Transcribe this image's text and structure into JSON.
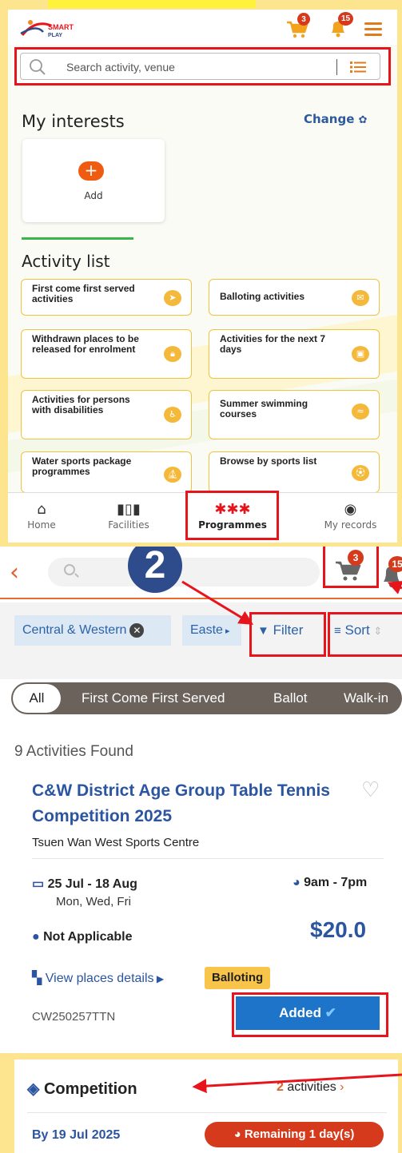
{
  "screen1": {
    "header": {
      "logo_top": "SMART",
      "logo_bottom": "PLAY",
      "cart_count": "3",
      "bell_count": "15",
      "icons": [
        "cart-icon",
        "bell-icon",
        "hamburger-menu-icon"
      ]
    },
    "search": {
      "placeholder": "Search activity, venue"
    },
    "interests": {
      "title": "My interests",
      "change_label": "Change",
      "add_label": "Add"
    },
    "activity_list": {
      "title": "Activity list",
      "items": [
        {
          "label": "First come first served activities",
          "icon": "paper-plane-icon"
        },
        {
          "label": "Balloting activities",
          "icon": "ballot-box-icon"
        },
        {
          "label": "Withdrawn places to be released for enrolment",
          "icon": "lock-icon"
        },
        {
          "label": "Activities for the next 7 days",
          "icon": "calendar-icon"
        },
        {
          "label": "Activities for persons with disabilities",
          "icon": "wheelchair-icon"
        },
        {
          "label": "Summer swimming courses",
          "icon": "swimming-icon"
        },
        {
          "label": "Water sports package programmes",
          "icon": "boat-icon"
        },
        {
          "label": "Browse by sports list",
          "icon": "ball-icon"
        }
      ]
    },
    "nav": [
      {
        "label": "Home",
        "icon": "home-icon"
      },
      {
        "label": "Facilities",
        "icon": "facilities-icon"
      },
      {
        "label": "Programmes",
        "icon": "programmes-icon"
      },
      {
        "label": "My records",
        "icon": "eye-icon"
      }
    ]
  },
  "step_number": "2",
  "screen2": {
    "cart_count": "3",
    "bell_count": "15",
    "chips": [
      "Central & Western",
      "Easte"
    ],
    "filter_label": "Filter",
    "sort_label": "Sort",
    "tabs": [
      "All",
      "First Come First Served",
      "Ballot",
      "Walk-in"
    ],
    "found_text": "9 Activities Found",
    "card": {
      "title": "C&W District Age Group Table Tennis Competition 2025",
      "venue": "Tsuen Wan West Sports Centre",
      "date": "25 Jul - 18 Aug",
      "days": "Mon, Wed, Fri",
      "time": "9am - 7pm",
      "eligibility": "Not Applicable",
      "price": "$20.0",
      "view_places": "View places details",
      "badge": "Balloting",
      "code": "CW250257TTN",
      "button": "Added"
    }
  },
  "screen3": {
    "category": "Competition",
    "count": "2",
    "count_suffix": "activities",
    "deadline": "By 19 Jul 2025",
    "remaining": "Remaining 1 day(s)"
  },
  "colors": {
    "frame_bg": "#fde58f",
    "highlight_red": "#e8141c",
    "orange": "#e0602a",
    "link_blue": "#2b55a0",
    "button_blue": "#1d74c8",
    "badge_yellow": "#f8c54a",
    "step_circle": "#2e4b8b"
  }
}
